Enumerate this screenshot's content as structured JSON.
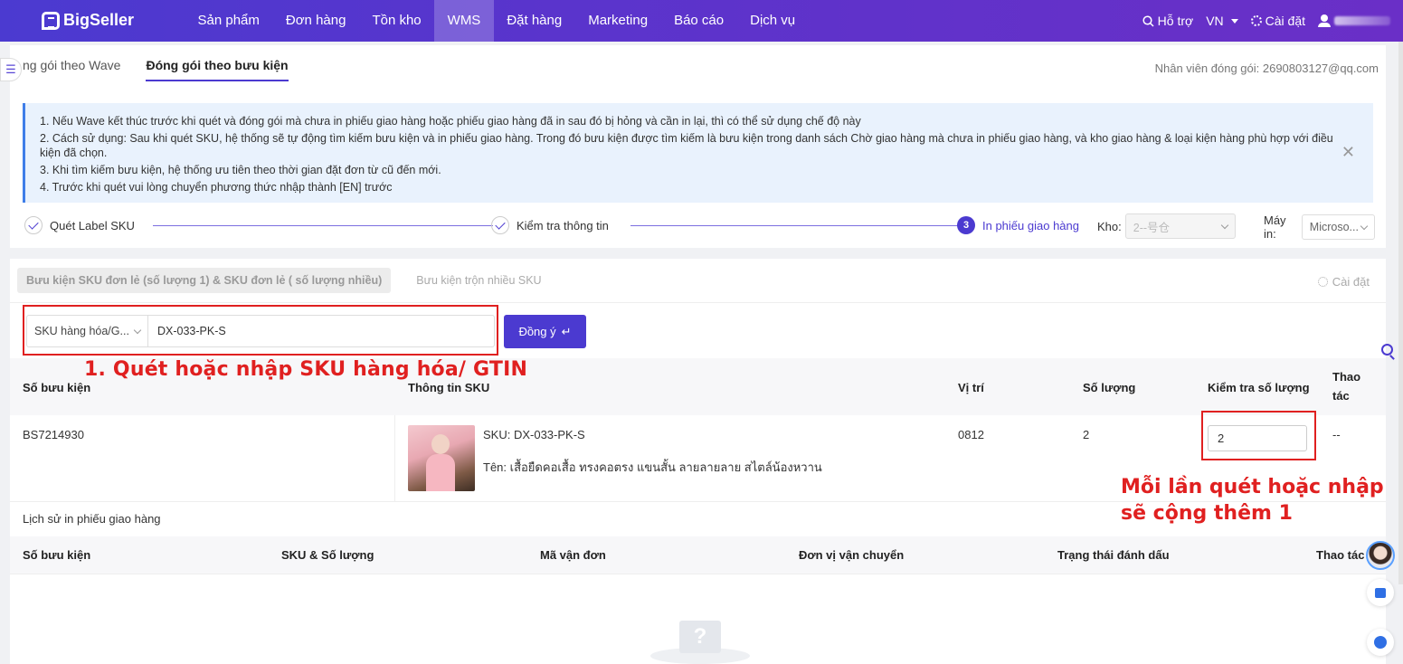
{
  "nav": {
    "logo": "BigSeller",
    "items": [
      "Sản phẩm",
      "Đơn hàng",
      "Tồn kho",
      "WMS",
      "Đặt hàng",
      "Marketing",
      "Báo cáo",
      "Dịch vụ"
    ],
    "active": "WMS",
    "support": "Hỗ trợ",
    "lang": "VN",
    "settings": "Cài đặt"
  },
  "tabs": [
    "ng gói theo Wave",
    "Đóng gói theo bưu kiện"
  ],
  "packer": "Nhân viên đóng gói: 2690803127@qq.com",
  "notes": [
    "1. Nếu Wave kết thúc trước khi quét và đóng gói mà chưa in phiếu giao hàng hoặc phiếu giao hàng đã in sau đó bị hỏng và cần in lại, thì có thể sử dụng chế độ này",
    "2. Cách sử dụng: Sau khi quét SKU, hệ thống sẽ tự động tìm kiếm bưu kiện và in phiếu giao hàng. Trong đó bưu kiện được tìm kiếm là bưu kiện trong danh sách Chờ giao hàng mà chưa in phiếu giao hàng, và kho giao hàng & loại kiện hàng phù hợp với điều kiện đã chọn.",
    "3. Khi tìm kiếm bưu kiện, hệ thống ưu tiên theo thời gian đặt đơn từ cũ đến mới.",
    "4. Trước khi quét vui lòng chuyển phương thức nhập thành [EN] trước"
  ],
  "steps": {
    "s1": "Quét Label SKU",
    "s2": "Kiểm tra thông tin",
    "s3_num": "3",
    "s3": "In phiếu giao hàng",
    "kho_label": "Kho:",
    "kho_value": "2--号仓",
    "printer_label": "Máy in:",
    "printer_value": "Microso..."
  },
  "subtabs": [
    "Bưu kiện SKU đơn lẻ (số lượng 1) & SKU đơn lẻ ( số lượng nhiều)",
    "Bưu kiện trộn nhiều SKU"
  ],
  "subsettings": "Cài đặt",
  "search": {
    "type": "SKU hàng hóa/G...",
    "value": "DX-033-PK-S",
    "button": "Đồng ý"
  },
  "annotation1": "1. Quét hoặc nhập SKU hàng hóa/ GTIN",
  "annotation2": [
    "Mỗi lần quét hoặc nhập",
    "sẽ cộng thêm 1"
  ],
  "table": {
    "headers": [
      "Số bưu kiện",
      "Thông tin SKU",
      "Vị trí",
      "Số lượng",
      "Kiểm tra số lượng",
      "Thao",
      "tác"
    ],
    "row": {
      "parcel": "BS7214930",
      "sku": "SKU: DX-033-PK-S",
      "name": "Tên: เสื้อยืดคอเสื้อ ทรงคอตรง แขนสั้น ลายลายลาย สไตล์น้องหวาน",
      "location": "0812",
      "qty": "2",
      "check": "2",
      "action": "--"
    }
  },
  "history": {
    "title": "Lịch sử in phiếu giao hàng",
    "headers": [
      "Số bưu kiện",
      "SKU & Số lượng",
      "Mã vận đơn",
      "Đơn vị vận chuyển",
      "Trạng thái đánh dấu",
      "Thao tác"
    ],
    "empty_glyph": "?"
  }
}
